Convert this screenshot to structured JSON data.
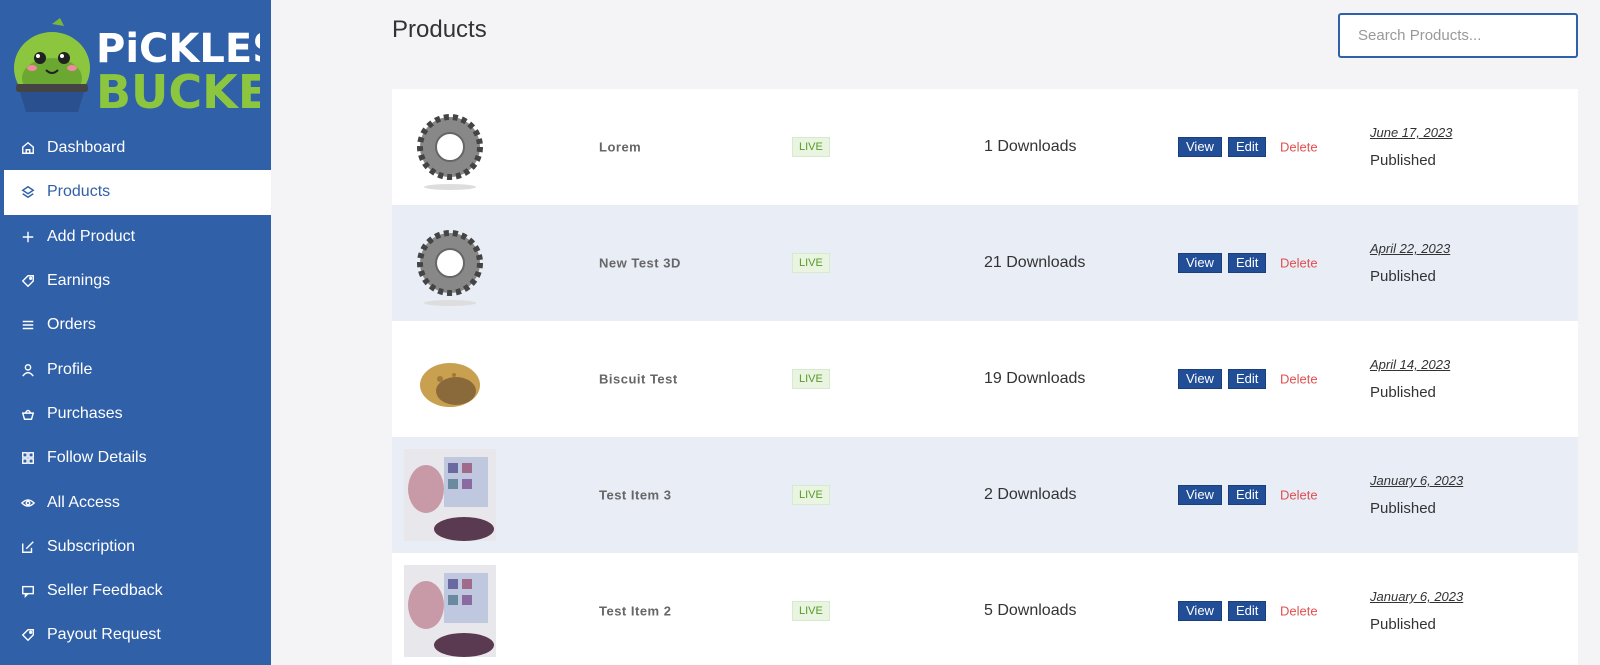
{
  "brand": {
    "line1": "PiCKLES",
    "line2": "BUCKET"
  },
  "sidebar": {
    "items": [
      {
        "label": "Dashboard",
        "icon": "home-icon",
        "active": false
      },
      {
        "label": "Products",
        "icon": "layers-icon",
        "active": true
      },
      {
        "label": "Add Product",
        "icon": "plus-icon",
        "active": false
      },
      {
        "label": "Earnings",
        "icon": "tag-icon",
        "active": false
      },
      {
        "label": "Orders",
        "icon": "list-icon",
        "active": false
      },
      {
        "label": "Profile",
        "icon": "user-icon",
        "active": false
      },
      {
        "label": "Purchases",
        "icon": "basket-icon",
        "active": false
      },
      {
        "label": "Follow Details",
        "icon": "grid-icon",
        "active": false
      },
      {
        "label": "All Access",
        "icon": "eye-icon",
        "active": false
      },
      {
        "label": "Subscription",
        "icon": "edit-icon",
        "active": false
      },
      {
        "label": "Seller Feedback",
        "icon": "chat-icon",
        "active": false
      },
      {
        "label": "Payout Request",
        "icon": "tag-icon",
        "active": false
      }
    ]
  },
  "main": {
    "title": "Products",
    "search_placeholder": "Search Products..."
  },
  "actions": {
    "view": "View",
    "edit": "Edit",
    "delete": "Delete"
  },
  "products": [
    {
      "thumb": "gear-icon",
      "name": "Lorem",
      "badge": "LIVE",
      "downloads": "1 Downloads",
      "date": "June 17, 2023",
      "status": "Published"
    },
    {
      "thumb": "gear-icon",
      "name": "New Test 3D",
      "badge": "LIVE",
      "downloads": "21 Downloads",
      "date": "April 22, 2023",
      "status": "Published"
    },
    {
      "thumb": "cookie-icon",
      "name": "Biscuit Test",
      "badge": "LIVE",
      "downloads": "19 Downloads",
      "date": "April 14, 2023",
      "status": "Published"
    },
    {
      "thumb": "photo-icon",
      "name": "Test Item 3",
      "badge": "LIVE",
      "downloads": "2 Downloads",
      "date": "January 6, 2023",
      "status": "Published"
    },
    {
      "thumb": "photo-icon",
      "name": "Test Item 2",
      "badge": "LIVE",
      "downloads": "5 Downloads",
      "date": "January 6, 2023",
      "status": "Published"
    }
  ]
}
